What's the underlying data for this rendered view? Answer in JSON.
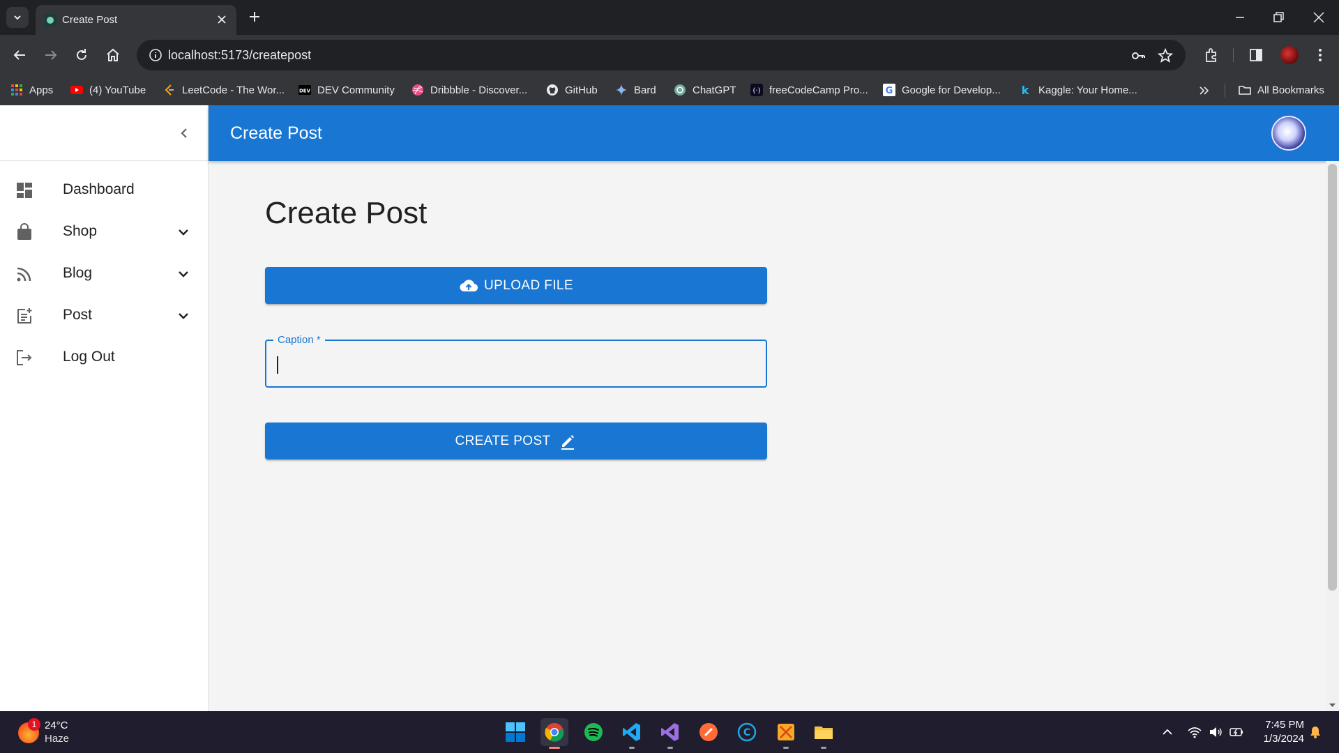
{
  "browser": {
    "tab_title": "Create Post",
    "url": "localhost:5173/createpost",
    "bookmarks": [
      {
        "label": "Apps",
        "icon": "apps-grid-icon"
      },
      {
        "label": "(4) YouTube",
        "icon": "youtube-icon"
      },
      {
        "label": "LeetCode - The Wor...",
        "icon": "leetcode-icon"
      },
      {
        "label": "DEV Community",
        "icon": "dev-icon"
      },
      {
        "label": "Dribbble - Discover...",
        "icon": "dribbble-icon"
      },
      {
        "label": "GitHub",
        "icon": "github-icon"
      },
      {
        "label": "Bard",
        "icon": "bard-icon"
      },
      {
        "label": "ChatGPT",
        "icon": "chatgpt-icon"
      },
      {
        "label": "freeCodeCamp Pro...",
        "icon": "freecodecamp-icon"
      },
      {
        "label": "Google for Develop...",
        "icon": "google-icon"
      },
      {
        "label": "Kaggle: Your Home...",
        "icon": "kaggle-icon"
      }
    ],
    "all_bookmarks_label": "All Bookmarks"
  },
  "app": {
    "appbar_title": "Create Post",
    "sidebar": {
      "items": [
        {
          "label": "Dashboard",
          "icon": "dashboard-icon",
          "expandable": false
        },
        {
          "label": "Shop",
          "icon": "shopping-bag-icon",
          "expandable": true
        },
        {
          "label": "Blog",
          "icon": "rss-feed-icon",
          "expandable": true
        },
        {
          "label": "Post",
          "icon": "post-add-icon",
          "expandable": true
        },
        {
          "label": "Log Out",
          "icon": "logout-icon",
          "expandable": false
        }
      ]
    },
    "page": {
      "heading": "Create Post",
      "upload_button_label": "UPLOAD FILE",
      "caption_label": "Caption *",
      "caption_value": "",
      "create_button_label": "CREATE POST"
    },
    "colors": {
      "primary": "#1976d2",
      "background": "#f4f4f4",
      "sidebar": "#ffffff"
    }
  },
  "taskbar": {
    "weather_temp": "24°C",
    "weather_condition": "Haze",
    "weather_badge": "1",
    "time": "7:45 PM",
    "date": "1/3/2024"
  }
}
